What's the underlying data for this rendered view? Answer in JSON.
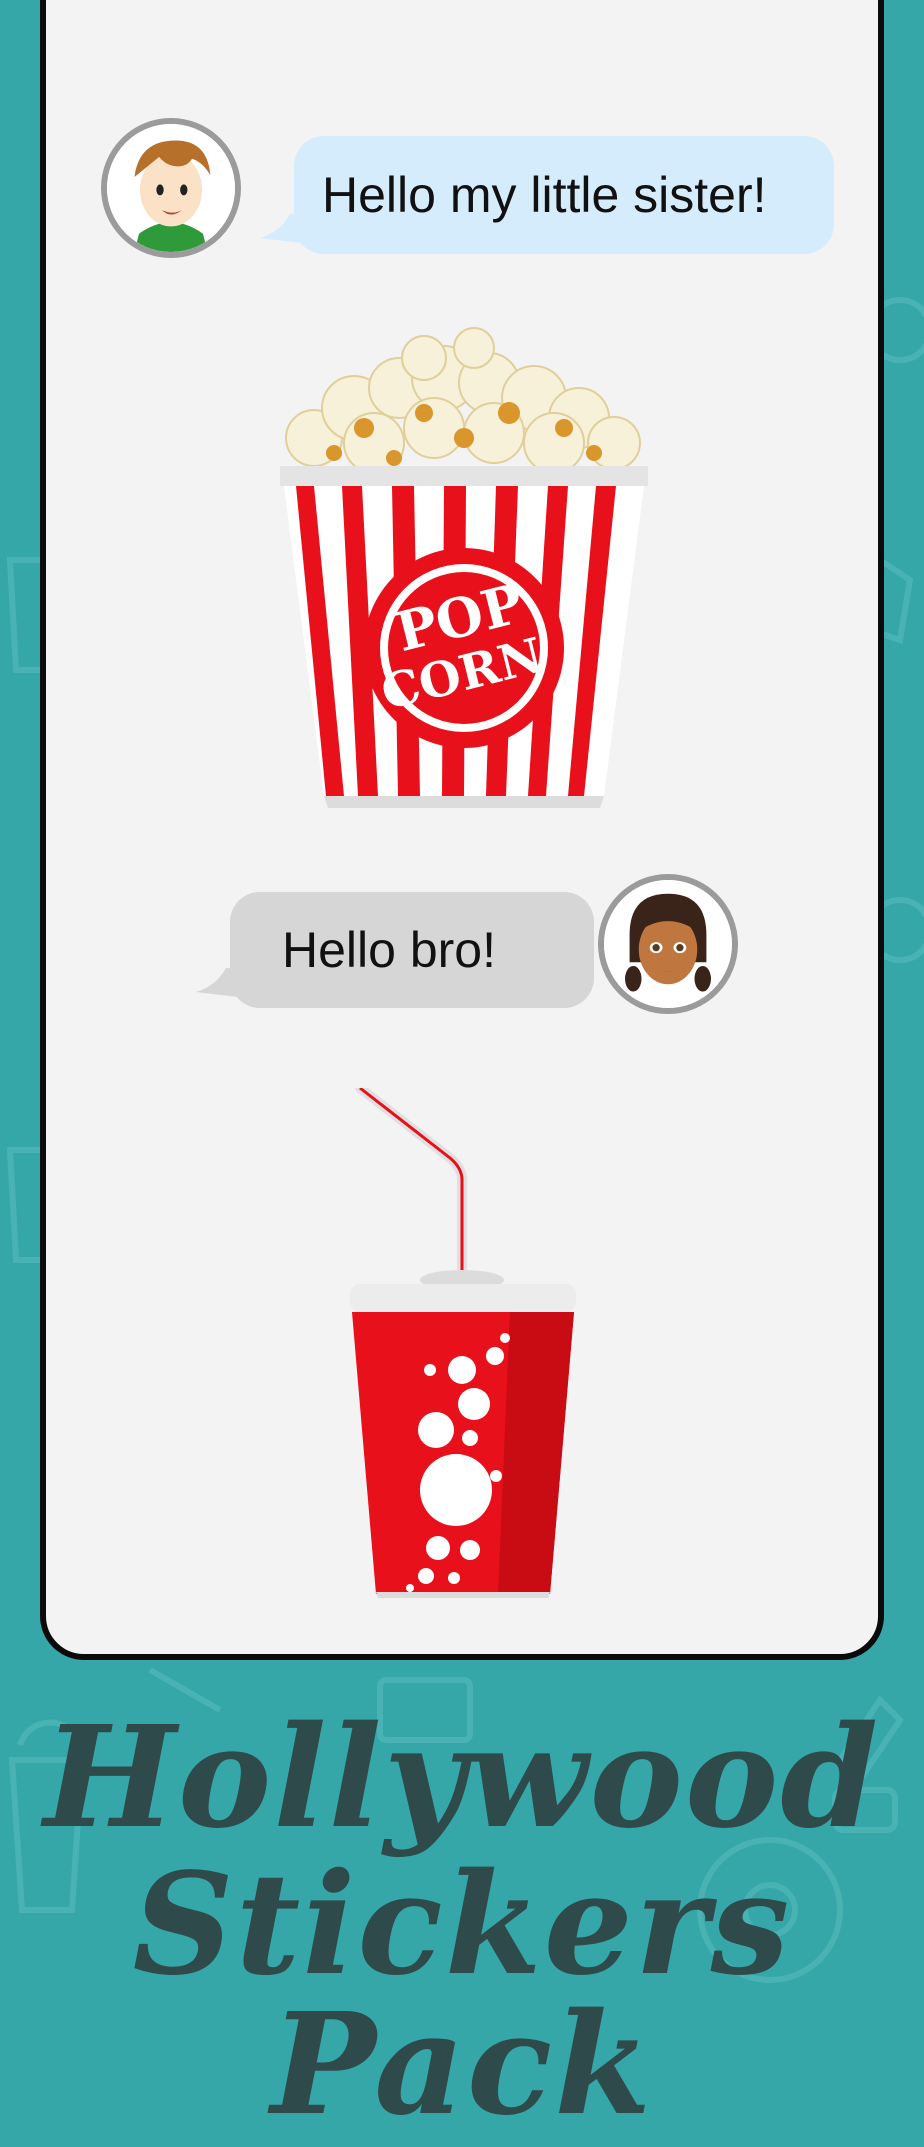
{
  "chat": {
    "message_1": {
      "text": "Hello my little sister!",
      "sender": "boy"
    },
    "message_2": {
      "text": "Hello bro!",
      "sender": "girl"
    }
  },
  "stickers": {
    "popcorn": {
      "label_line_1": "POP",
      "label_line_2": "CORN"
    },
    "soda": {}
  },
  "title": {
    "line_1": "Hollywood",
    "line_2": "Stickers Pack"
  },
  "colors": {
    "background": "#35a7a8",
    "phone_screen": "#f3f3f3",
    "phone_border": "#0b0b0b",
    "bubble_blue": "#d5ecfc",
    "bubble_gray": "#d7d6d6",
    "sticker_red": "#e8101a",
    "title": "#2f4a4b"
  }
}
